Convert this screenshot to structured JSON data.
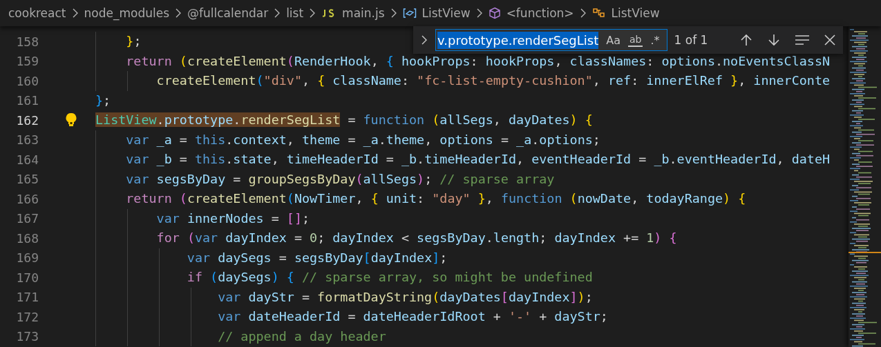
{
  "breadcrumb": [
    {
      "label": "cookreact",
      "kind": "folder"
    },
    {
      "label": "node_modules",
      "kind": "folder"
    },
    {
      "label": "@fullcalendar",
      "kind": "folder"
    },
    {
      "label": "list",
      "kind": "folder"
    },
    {
      "label": "main.js",
      "kind": "js"
    },
    {
      "label": "ListView",
      "kind": "variable"
    },
    {
      "label": "<function>",
      "kind": "function"
    },
    {
      "label": "ListView",
      "kind": "class"
    }
  ],
  "find_widget": {
    "value": "v.prototype.renderSegList",
    "options": [
      {
        "label": "Aa",
        "on": false
      },
      {
        "label": "ab",
        "on": false
      },
      {
        "label": ".*",
        "on": false
      }
    ],
    "match_count": "1 of 1"
  },
  "editor": {
    "lines": [
      {
        "number": "158",
        "current": false,
        "lightbulb": false,
        "tokens": [
          {
            "text": "    }",
            "kind": "y"
          },
          {
            "text": ";",
            "kind": "p"
          }
        ]
      },
      {
        "number": "159",
        "current": false,
        "lightbulb": false,
        "tokens": [
          {
            "text": "    return ",
            "kind": "kw"
          },
          {
            "text": "(",
            "kind": "y"
          },
          {
            "text": "createElement",
            "kind": "fn"
          },
          {
            "text": "(",
            "kind": "m"
          },
          {
            "text": "RenderHook",
            "kind": "v"
          },
          {
            "text": ", ",
            "kind": "p"
          },
          {
            "text": "{ ",
            "kind": "b"
          },
          {
            "text": "hookProps",
            "kind": "v"
          },
          {
            "text": ": ",
            "kind": "p"
          },
          {
            "text": "hookProps",
            "kind": "v"
          },
          {
            "text": ", ",
            "kind": "p"
          },
          {
            "text": "classNames",
            "kind": "v"
          },
          {
            "text": ": ",
            "kind": "p"
          },
          {
            "text": "options",
            "kind": "v"
          },
          {
            "text": ".",
            "kind": "p"
          },
          {
            "text": "noEventsClassN",
            "kind": "v"
          }
        ]
      },
      {
        "number": "160",
        "current": false,
        "lightbulb": false,
        "tokens": [
          {
            "text": "        createElement",
            "kind": "fn"
          },
          {
            "text": "(",
            "kind": "b"
          },
          {
            "text": "\"div\"",
            "kind": "s"
          },
          {
            "text": ", ",
            "kind": "p"
          },
          {
            "text": "{ ",
            "kind": "y"
          },
          {
            "text": "className",
            "kind": "v"
          },
          {
            "text": ": ",
            "kind": "p"
          },
          {
            "text": "\"fc-list-empty-cushion\"",
            "kind": "s"
          },
          {
            "text": ", ",
            "kind": "p"
          },
          {
            "text": "ref",
            "kind": "v"
          },
          {
            "text": ": ",
            "kind": "p"
          },
          {
            "text": "innerElRef ",
            "kind": "v"
          },
          {
            "text": "}",
            "kind": "y"
          },
          {
            "text": ", ",
            "kind": "p"
          },
          {
            "text": "innerConte",
            "kind": "v"
          }
        ]
      },
      {
        "number": "161",
        "current": false,
        "lightbulb": false,
        "tokens": [
          {
            "text": "}",
            "kind": "b"
          },
          {
            "text": ";",
            "kind": "p"
          }
        ]
      },
      {
        "number": "162",
        "current": true,
        "lightbulb": true,
        "tokens": [
          {
            "text": "ListView",
            "kind": "c",
            "match": true
          },
          {
            "text": ".",
            "kind": "p",
            "match": true
          },
          {
            "text": "prototype",
            "kind": "v",
            "match": true
          },
          {
            "text": ".",
            "kind": "p",
            "match": true
          },
          {
            "text": "renderSegList",
            "kind": "fn",
            "match": true
          },
          {
            "text": " = ",
            "kind": "p",
            "match": false
          },
          {
            "text": "function ",
            "kind": "st",
            "match": false
          },
          {
            "text": "(",
            "kind": "y",
            "match": false
          },
          {
            "text": "allSegs",
            "kind": "v",
            "match": false
          },
          {
            "text": ", ",
            "kind": "p",
            "match": false
          },
          {
            "text": "dayDates",
            "kind": "v",
            "match": false
          },
          {
            "text": ")",
            "kind": "y",
            "match": false
          },
          {
            "text": " {",
            "kind": "y",
            "match": false
          }
        ]
      },
      {
        "number": "163",
        "current": false,
        "lightbulb": false,
        "tokens": [
          {
            "text": "    var ",
            "kind": "st"
          },
          {
            "text": "_a",
            "kind": "v"
          },
          {
            "text": " = ",
            "kind": "p"
          },
          {
            "text": "this",
            "kind": "st"
          },
          {
            "text": ".",
            "kind": "p"
          },
          {
            "text": "context",
            "kind": "v"
          },
          {
            "text": ", ",
            "kind": "p"
          },
          {
            "text": "theme",
            "kind": "v"
          },
          {
            "text": " = ",
            "kind": "p"
          },
          {
            "text": "_a",
            "kind": "v"
          },
          {
            "text": ".",
            "kind": "p"
          },
          {
            "text": "theme",
            "kind": "v"
          },
          {
            "text": ", ",
            "kind": "p"
          },
          {
            "text": "options",
            "kind": "v"
          },
          {
            "text": " = ",
            "kind": "p"
          },
          {
            "text": "_a",
            "kind": "v"
          },
          {
            "text": ".",
            "kind": "p"
          },
          {
            "text": "options",
            "kind": "v"
          },
          {
            "text": ";",
            "kind": "p"
          }
        ]
      },
      {
        "number": "164",
        "current": false,
        "lightbulb": false,
        "tokens": [
          {
            "text": "    var ",
            "kind": "st"
          },
          {
            "text": "_b",
            "kind": "v"
          },
          {
            "text": " = ",
            "kind": "p"
          },
          {
            "text": "this",
            "kind": "st"
          },
          {
            "text": ".",
            "kind": "p"
          },
          {
            "text": "state",
            "kind": "v"
          },
          {
            "text": ", ",
            "kind": "p"
          },
          {
            "text": "timeHeaderId",
            "kind": "v"
          },
          {
            "text": " = ",
            "kind": "p"
          },
          {
            "text": "_b",
            "kind": "v"
          },
          {
            "text": ".",
            "kind": "p"
          },
          {
            "text": "timeHeaderId",
            "kind": "v"
          },
          {
            "text": ", ",
            "kind": "p"
          },
          {
            "text": "eventHeaderId",
            "kind": "v"
          },
          {
            "text": " = ",
            "kind": "p"
          },
          {
            "text": "_b",
            "kind": "v"
          },
          {
            "text": ".",
            "kind": "p"
          },
          {
            "text": "eventHeaderId",
            "kind": "v"
          },
          {
            "text": ", ",
            "kind": "p"
          },
          {
            "text": "dateH",
            "kind": "v"
          }
        ]
      },
      {
        "number": "165",
        "current": false,
        "lightbulb": false,
        "tokens": [
          {
            "text": "    var ",
            "kind": "st"
          },
          {
            "text": "segsByDay",
            "kind": "v"
          },
          {
            "text": " = ",
            "kind": "p"
          },
          {
            "text": "groupSegsByDay",
            "kind": "fn"
          },
          {
            "text": "(",
            "kind": "m"
          },
          {
            "text": "allSegs",
            "kind": "v"
          },
          {
            "text": ")",
            "kind": "m"
          },
          {
            "text": "; ",
            "kind": "p"
          },
          {
            "text": "// sparse array",
            "kind": "cm"
          }
        ]
      },
      {
        "number": "166",
        "current": false,
        "lightbulb": false,
        "tokens": [
          {
            "text": "    return ",
            "kind": "kw"
          },
          {
            "text": "(",
            "kind": "m"
          },
          {
            "text": "createElement",
            "kind": "fn"
          },
          {
            "text": "(",
            "kind": "b"
          },
          {
            "text": "NowTimer",
            "kind": "v"
          },
          {
            "text": ", ",
            "kind": "p"
          },
          {
            "text": "{ ",
            "kind": "y"
          },
          {
            "text": "unit",
            "kind": "v"
          },
          {
            "text": ": ",
            "kind": "p"
          },
          {
            "text": "\"day\"",
            "kind": "s"
          },
          {
            "text": " }",
            "kind": "y"
          },
          {
            "text": ", ",
            "kind": "p"
          },
          {
            "text": "function ",
            "kind": "st"
          },
          {
            "text": "(",
            "kind": "y"
          },
          {
            "text": "nowDate",
            "kind": "v"
          },
          {
            "text": ", ",
            "kind": "p"
          },
          {
            "text": "todayRange",
            "kind": "v"
          },
          {
            "text": ")",
            "kind": "y"
          },
          {
            "text": " {",
            "kind": "y"
          }
        ]
      },
      {
        "number": "167",
        "current": false,
        "lightbulb": false,
        "tokens": [
          {
            "text": "        var ",
            "kind": "st"
          },
          {
            "text": "innerNodes",
            "kind": "v"
          },
          {
            "text": " = ",
            "kind": "p"
          },
          {
            "text": "[]",
            "kind": "m"
          },
          {
            "text": ";",
            "kind": "p"
          }
        ]
      },
      {
        "number": "168",
        "current": false,
        "lightbulb": false,
        "tokens": [
          {
            "text": "        for ",
            "kind": "kw"
          },
          {
            "text": "(",
            "kind": "m"
          },
          {
            "text": "var ",
            "kind": "st"
          },
          {
            "text": "dayIndex",
            "kind": "v"
          },
          {
            "text": " = ",
            "kind": "p"
          },
          {
            "text": "0",
            "kind": "n"
          },
          {
            "text": "; ",
            "kind": "p"
          },
          {
            "text": "dayIndex",
            "kind": "v"
          },
          {
            "text": " < ",
            "kind": "p"
          },
          {
            "text": "segsByDay",
            "kind": "v"
          },
          {
            "text": ".",
            "kind": "p"
          },
          {
            "text": "length",
            "kind": "v"
          },
          {
            "text": "; ",
            "kind": "p"
          },
          {
            "text": "dayIndex",
            "kind": "v"
          },
          {
            "text": " += ",
            "kind": "p"
          },
          {
            "text": "1",
            "kind": "n"
          },
          {
            "text": ")",
            "kind": "m"
          },
          {
            "text": " {",
            "kind": "m"
          }
        ]
      },
      {
        "number": "169",
        "current": false,
        "lightbulb": false,
        "tokens": [
          {
            "text": "            var ",
            "kind": "st"
          },
          {
            "text": "daySegs",
            "kind": "v"
          },
          {
            "text": " = ",
            "kind": "p"
          },
          {
            "text": "segsByDay",
            "kind": "v"
          },
          {
            "text": "[",
            "kind": "b"
          },
          {
            "text": "dayIndex",
            "kind": "v"
          },
          {
            "text": "]",
            "kind": "b"
          },
          {
            "text": ";",
            "kind": "p"
          }
        ]
      },
      {
        "number": "170",
        "current": false,
        "lightbulb": false,
        "tokens": [
          {
            "text": "            if ",
            "kind": "kw"
          },
          {
            "text": "(",
            "kind": "b"
          },
          {
            "text": "daySegs",
            "kind": "v"
          },
          {
            "text": ")",
            "kind": "b"
          },
          {
            "text": " {",
            "kind": "b"
          },
          {
            "text": " // sparse array, so might be undefined",
            "kind": "cm"
          }
        ]
      },
      {
        "number": "171",
        "current": false,
        "lightbulb": false,
        "tokens": [
          {
            "text": "                var ",
            "kind": "st"
          },
          {
            "text": "dayStr",
            "kind": "v"
          },
          {
            "text": " = ",
            "kind": "p"
          },
          {
            "text": "formatDayString",
            "kind": "fn"
          },
          {
            "text": "(",
            "kind": "y"
          },
          {
            "text": "dayDates",
            "kind": "v"
          },
          {
            "text": "[",
            "kind": "m"
          },
          {
            "text": "dayIndex",
            "kind": "v"
          },
          {
            "text": "]",
            "kind": "m"
          },
          {
            "text": ")",
            "kind": "y"
          },
          {
            "text": ";",
            "kind": "p"
          }
        ]
      },
      {
        "number": "172",
        "current": false,
        "lightbulb": false,
        "tokens": [
          {
            "text": "                var ",
            "kind": "st"
          },
          {
            "text": "dateHeaderId",
            "kind": "v"
          },
          {
            "text": " = ",
            "kind": "p"
          },
          {
            "text": "dateHeaderIdRoot",
            "kind": "v"
          },
          {
            "text": " + ",
            "kind": "p"
          },
          {
            "text": "'-'",
            "kind": "s"
          },
          {
            "text": " + ",
            "kind": "p"
          },
          {
            "text": "dayStr",
            "kind": "v"
          },
          {
            "text": ";",
            "kind": "p"
          }
        ]
      },
      {
        "number": "173",
        "current": false,
        "lightbulb": false,
        "tokens": [
          {
            "text": "                // append a day header",
            "kind": "cm"
          }
        ]
      }
    ]
  }
}
